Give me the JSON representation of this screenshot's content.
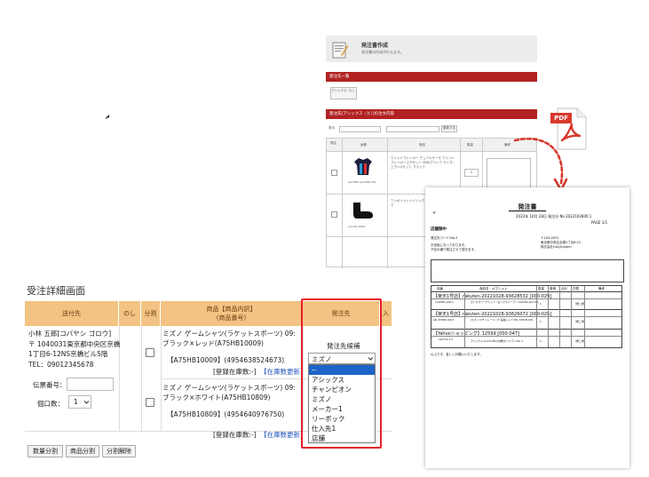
{
  "order_form": {
    "title": "発注書作成",
    "subtitle": "発注書の作成が行えます。",
    "section_supplier_list": "発注先一覧",
    "supplier_button": "アシックス（ヒ）",
    "section_selected_supplier": "発注先[アシックス（ヒ）]の注文内容",
    "filter_label": "表示",
    "update_label": "更新する",
    "columns": [
      "発注",
      "画像",
      "商品",
      "数量",
      "備考"
    ],
    "items": [
      {
        "product": "ウインドブレーカー デュアルサーモ ウインドブレーカー上下セット ISBKブラック サイズ: 上下＝Oセット ブラック",
        "qty": "1",
        "code": "sw738m sw738m-90"
      },
      {
        "product": "ワンポイントハイソックス 品番: 24-0 ブラック",
        "qty": "1",
        "code": "xvs701-0001"
      }
    ]
  },
  "pdf": {
    "badge": "PDF",
    "title": "発注書",
    "date_line": "2022年 10月 28日 発注分 No.2022102800 1",
    "page": "PAGE 1/1",
    "addressee": "店舗御中",
    "label_orderer": "発注先コード:No.3",
    "line2": "お世話になっております。",
    "line3": "下記の通り発注させて頂きます。",
    "sender_zip": "〒104-0031",
    "sender_addr": "東京都中央区京橋1丁目6-12",
    "sender_name": "株式会社GoQSystem",
    "table_header": [
      "品番",
      "商品名・オプション",
      "数量",
      "単価",
      "合計",
      "在庫",
      "備考"
    ],
    "sections": [
      {
        "head": "【楽天1号店】rakuten-20221028-93628532 [000-029]",
        "code": "cas1581-ph0-1",
        "name": "ロングスリーブシャツ（ロングスリーブ）cas1581-ph0 2XL",
        "qty": "1",
        "note": "（発二重）"
      },
      {
        "head": "【楽天1号店】rakuten-20221028-93626072 [000-025]",
        "code": "aib-4391B-100-3",
        "name": "[ミズノ] DF トレーニング 長袖シャツ 2XL 4391B-100",
        "qty": "1",
        "note": "（発二重）"
      },
      {
        "head": "【Yahooショッピング】12599 [000-047]",
        "code": "1jsr711-1-2",
        "name": "アシックス ComfortDry中敷き(ハイテ) (32) 1",
        "qty": "1",
        "note": "（発二重）"
      }
    ],
    "footer": "以上です。宜しくお願いいたします。"
  },
  "detail": {
    "page_title": "受注詳細画面",
    "columns": {
      "ship_to": "送付先",
      "noshi": "のし",
      "split": "分割",
      "product_line1": "商品【商品内訳】",
      "product_line2": "(商品番号)",
      "supplier": "発注先",
      "extra": "入"
    },
    "customer": {
      "name": "小林 五郎[コバヤシ ゴロウ]",
      "addr1": "〒 1040031東京都中央区京橋",
      "addr2": "1丁目6-12NS京橋ビル5階",
      "tel": "TEL：09012345678"
    },
    "slip_label": "伝票番号：",
    "slip_value": "",
    "count_label": "個口数：",
    "count_value": "1",
    "products": [
      {
        "name1": "ミズノ ゲームシャツ(ラケットスポーツ) 09:",
        "name2": "ブラック×レッド(A75HB10009)",
        "code": "【A75HB10009】(4954638524673)",
        "stock": "[登録在庫数:-]",
        "stock_link": "【在庫数更新】"
      },
      {
        "name1": "ミズノ ゲームシャツ(ラケットスポーツ) 09:",
        "name2": "ブラック×ホワイト(A75HB10809)",
        "code": "【A75HB10809】(4954640976750)",
        "stock": "[登録在庫数:-]",
        "stock_link": "【在庫数更新】"
      }
    ],
    "supplier_candidate_label": "発注先候補",
    "supplier_selected": "ミズノ",
    "dropdown_options": [
      "--",
      "アシックス",
      "チャンピオン",
      "ミズノ",
      "メーカー1",
      "リーボック",
      "仕入先1",
      "店舗"
    ],
    "buttons": [
      "数量分割",
      "商品分割",
      "分割解除"
    ]
  },
  "colors": {
    "accent_red": "#b22222",
    "header_orange": "#f2c383",
    "highlight_box": "#e5202a",
    "pdf_red": "#d8382c"
  }
}
